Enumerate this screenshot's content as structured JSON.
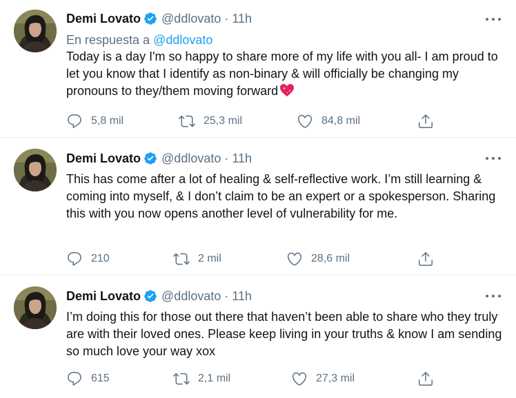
{
  "colors": {
    "verified_badge": "#1da1f2",
    "link": "#1da1f2",
    "secondary_text": "#5b7083",
    "primary_text": "#0f1419",
    "divider": "#ebeef0"
  },
  "icons": {
    "more": "more-horizontal-icon",
    "reply": "reply-bubble-icon",
    "retweet": "retweet-icon",
    "like": "heart-outline-icon",
    "share": "share-upload-icon",
    "verified": "verified-badge-icon",
    "emoji": "sparkling-heart-emoji"
  },
  "tweets": [
    {
      "author_name": "Demi Lovato",
      "handle": "@ddlovato",
      "separator": "·",
      "time": "11h",
      "reply_prefix": "En respuesta a",
      "reply_handle": "@ddlovato",
      "text": "Today is a day I'm so happy to share more of my life with you all- I am proud to let you know that I identify as non-binary & will officially be changing my pronouns to they/them moving forward",
      "replies": "5,8 mil",
      "retweets": "25,3 mil",
      "likes": "84,8 mil"
    },
    {
      "author_name": "Demi Lovato",
      "handle": "@ddlovato",
      "separator": "·",
      "time": "11h",
      "text": "This has come after a lot of healing & self-reflective work. I’m still learning & coming into myself, & I don’t claim to be an expert or a spokesperson. Sharing this with you now opens another level of vulnerability for me.",
      "replies": "210",
      "retweets": "2 mil",
      "likes": "28,6 mil"
    },
    {
      "author_name": "Demi Lovato",
      "handle": "@ddlovato",
      "separator": "·",
      "time": "11h",
      "text": "I’m doing this for those out there that haven’t been able to share who they truly are with their loved ones. Please keep living in your truths & know I am sending so much love your way xox",
      "replies": "615",
      "retweets": "2,1 mil",
      "likes": "27,3 mil"
    }
  ]
}
